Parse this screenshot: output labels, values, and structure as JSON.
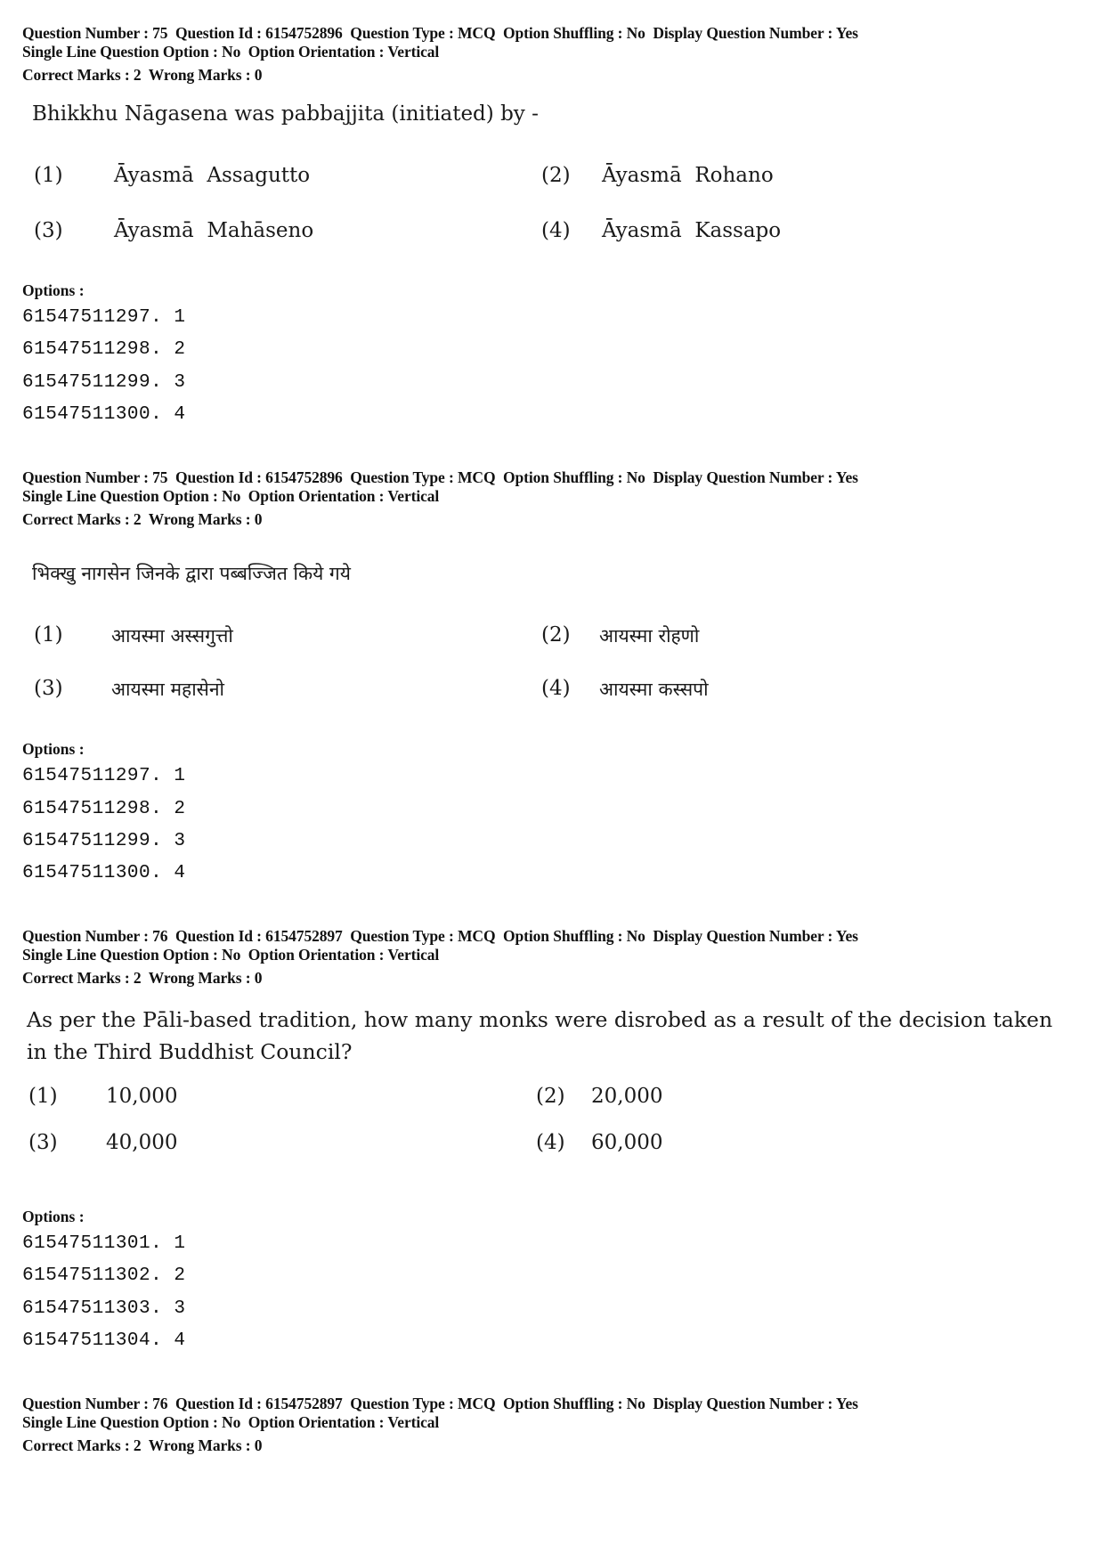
{
  "blocks": [
    {
      "meta": {
        "line1": "Question Number : 75  Question Id : 6154752896  Question Type : MCQ  Option Shuffling : No  Display Question Number : Yes",
        "line2": "Single Line Question Option : No  Option Orientation : Vertical",
        "marks": "Correct Marks : 2  Wrong Marks : 0"
      },
      "question": "Bhikkhu Nāgasena was pabbajjita (initiated) by -",
      "choices": [
        {
          "num": "(1)",
          "text": "Āyasmā  Assagutto"
        },
        {
          "num": "(2)",
          "text": "Āyasmā  Rohano"
        },
        {
          "num": "(3)",
          "text": "Āyasmā  Mahāseno"
        },
        {
          "num": "(4)",
          "text": "Āyasmā  Kassapo"
        }
      ],
      "options_label": "Options :",
      "option_ids": [
        "61547511297. 1",
        "61547511298. 2",
        "61547511299. 3",
        "61547511300. 4"
      ]
    },
    {
      "meta": {
        "line1": "Question Number : 75  Question Id : 6154752896  Question Type : MCQ  Option Shuffling : No  Display Question Number : Yes",
        "line2": "Single Line Question Option : No  Option Orientation : Vertical",
        "marks": "Correct Marks : 2  Wrong Marks : 0"
      },
      "question": "भिक्खु नागसेन जिनके द्वारा पब्बज्जित किये गये",
      "choices": [
        {
          "num": "(1)",
          "text": "आयस्मा अस्सगुत्तो"
        },
        {
          "num": "(2)",
          "text": "आयस्मा रोहणो"
        },
        {
          "num": "(3)",
          "text": "आयस्मा महासेनो"
        },
        {
          "num": "(4)",
          "text": "आयस्मा कस्सपो"
        }
      ],
      "options_label": "Options :",
      "option_ids": [
        "61547511297. 1",
        "61547511298. 2",
        "61547511299. 3",
        "61547511300. 4"
      ]
    },
    {
      "meta": {
        "line1": "Question Number : 76  Question Id : 6154752897  Question Type : MCQ  Option Shuffling : No  Display Question Number : Yes",
        "line2": "Single Line Question Option : No  Option Orientation : Vertical",
        "marks": "Correct Marks : 2  Wrong Marks : 0"
      },
      "question": "As per the Pāli-based tradition, how many monks were disrobed as a result of the decision taken in the Third Buddhist Council?",
      "choices": [
        {
          "num": "(1)",
          "text": "10,000"
        },
        {
          "num": "(2)",
          "text": "20,000"
        },
        {
          "num": "(3)",
          "text": "40,000"
        },
        {
          "num": "(4)",
          "text": "60,000"
        }
      ],
      "options_label": "Options :",
      "option_ids": [
        "61547511301. 1",
        "61547511302. 2",
        "61547511303. 3",
        "61547511304. 4"
      ]
    },
    {
      "meta": {
        "line1": "Question Number : 76  Question Id : 6154752897  Question Type : MCQ  Option Shuffling : No  Display Question Number : Yes",
        "line2": "Single Line Question Option : No  Option Orientation : Vertical",
        "marks": "Correct Marks : 2  Wrong Marks : 0"
      }
    }
  ]
}
